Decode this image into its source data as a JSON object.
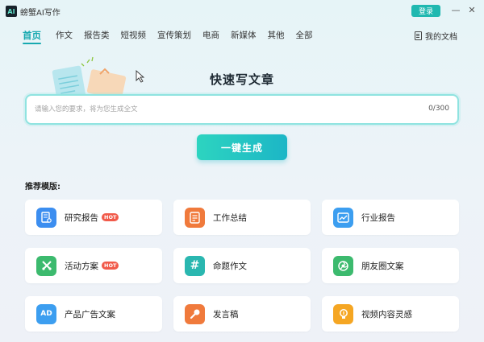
{
  "app": {
    "logo_text": "AI",
    "title": "螃蟹AI写作",
    "login_label": "登录",
    "minimize_glyph": "—",
    "close_glyph": "✕"
  },
  "nav": {
    "items": [
      {
        "label": "首页",
        "active": true
      },
      {
        "label": "作文"
      },
      {
        "label": "报告类"
      },
      {
        "label": "短视频"
      },
      {
        "label": "宣传策划"
      },
      {
        "label": "电商"
      },
      {
        "label": "新媒体"
      },
      {
        "label": "其他"
      },
      {
        "label": "全部"
      }
    ],
    "my_docs": "我的文档"
  },
  "hero": {
    "title": "快速写文章"
  },
  "prompt": {
    "placeholder": "请输入您的要求，将为您生成全文",
    "count": "0/300"
  },
  "generate_label": "一键生成",
  "templates": {
    "label": "推荐模版:",
    "hot_badge": "HOT",
    "items": [
      {
        "label": "研究报告",
        "icon": "research-report-icon",
        "color": "#3c8ef0",
        "hot": true
      },
      {
        "label": "工作总结",
        "icon": "work-summary-icon",
        "color": "#f07a3c"
      },
      {
        "label": "行业报告",
        "icon": "industry-report-icon",
        "color": "#3c9ef0"
      },
      {
        "label": "活动方案",
        "icon": "activity-plan-icon",
        "color": "#3cba6e",
        "hot": true
      },
      {
        "label": "命题作文",
        "icon": "essay-icon",
        "color": "#2ab7b0"
      },
      {
        "label": "朋友圈文案",
        "icon": "moments-icon",
        "color": "#3cba6e"
      },
      {
        "label": "产品广告文案",
        "icon": "ad-icon",
        "color": "#3c9ef0"
      },
      {
        "label": "发言稿",
        "icon": "microphone-icon",
        "color": "#f07a3c"
      },
      {
        "label": "视频内容灵感",
        "icon": "lightbulb-icon",
        "color": "#f5a623"
      }
    ]
  }
}
